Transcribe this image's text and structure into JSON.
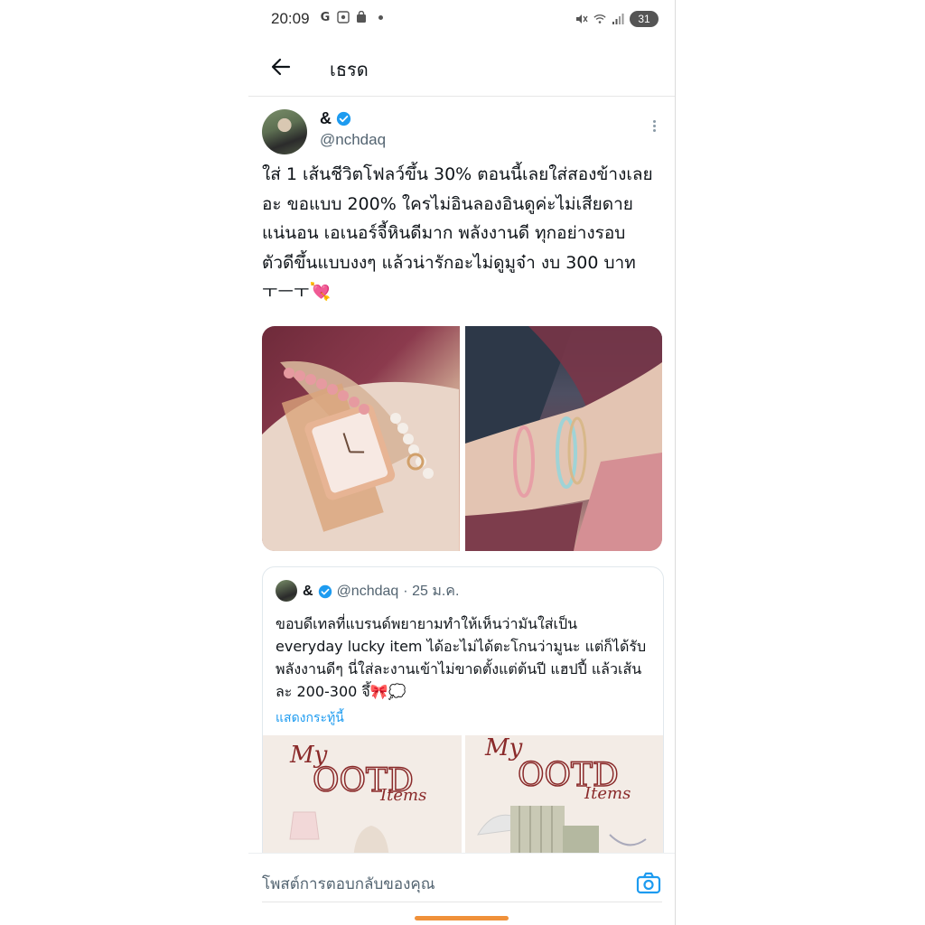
{
  "status_bar": {
    "time": "20:09",
    "battery": "31"
  },
  "app_bar": {
    "title": "เธรด"
  },
  "post": {
    "display_name": "&",
    "handle": "@nchdaq",
    "text": "ใส่ 1 เส้นชีวิตโฟลว์ขึ้น 30% ตอนนี้เลยใส่สองข้างเลย\nอะ ขอแบบ 200% ใครไม่อินลองอินดูค่ะไม่เสียดาย\nแน่นอน เอเนอร์จี้หินดีมาก พลังงานดี ทุกอย่างรอบ\nตัวดีขึ้นแบบงงๆ แล้วน่ารักอะไม่ดูมูจ๋า งบ 300 บาท\nㅜㅡㅜ💘",
    "accent_color": "#1d9bf0"
  },
  "quote": {
    "display_name": "&",
    "handle": "@nchdaq",
    "date": "· 25 ม.ค.",
    "text": "ขอบดีเทลที่แบรนด์พยายามทำให้เห็นว่ามันใส่เป็น\neveryday lucky item ได้อะไม่ได้ตะโกนว่ามูนะ แต่ก็ได้รับ\nพลังงานดีๆ นี่ใส่ละงานเข้าไม่ขาดตั้งแต่ต้นปี แฮปปี้ แล้วเส้น\nละ 200-300 จึ้🎀💭",
    "show_more": "แสดงกระทู้นี้",
    "images": [
      {
        "line1": "My",
        "line2": "OOTD",
        "line3": "Items"
      },
      {
        "line1": "My",
        "line2": "OOTD",
        "line3": "Items"
      }
    ]
  },
  "reply": {
    "placeholder": "โพสต์การตอบกลับของคุณ"
  }
}
